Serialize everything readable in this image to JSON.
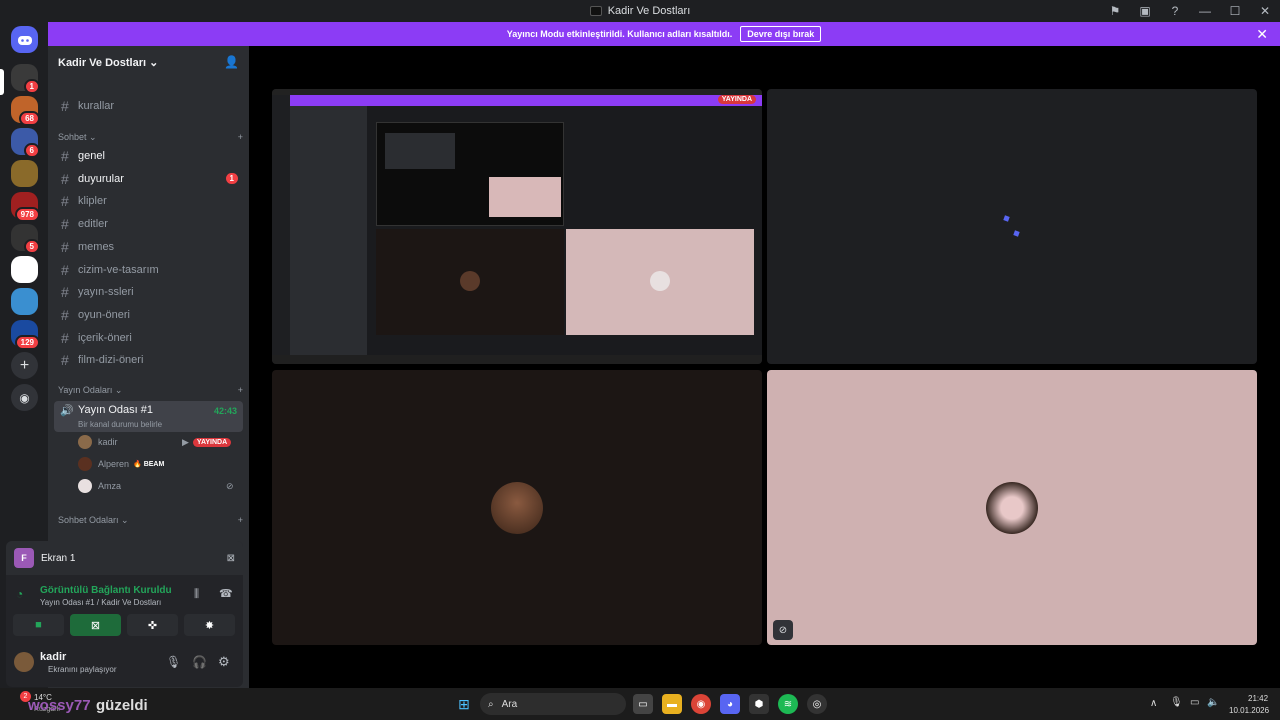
{
  "window": {
    "title": "Kadir Ve Dostları"
  },
  "banner": {
    "text": "Yayıncı Modu etkinleştirildi. Kullanıcı adları kısaltıldı.",
    "button": "Devre dışı bırak"
  },
  "servers": {
    "items": [
      {
        "name": "KADIRCAN",
        "badge": "1",
        "color": "#3a3a3a"
      },
      {
        "name": "server-2",
        "badge": "68",
        "color": "#c0642a"
      },
      {
        "name": "server-3",
        "badge": "6",
        "color": "#3c5aa8"
      },
      {
        "name": "server-4",
        "badge": "",
        "color": "#8a6a2a"
      },
      {
        "name": "server-5",
        "badge": "978",
        "color": "#a02020"
      },
      {
        "name": "server-6",
        "badge": "5",
        "color": "#333333"
      },
      {
        "name": "server-7",
        "badge": "",
        "color": "#ffffff"
      },
      {
        "name": "server-8",
        "badge": "",
        "color": "#3a8fd0"
      },
      {
        "name": "server-9",
        "badge": "129",
        "color": "#1a4aa0"
      }
    ]
  },
  "guild": {
    "name": "Kadir Ve Dostları"
  },
  "channels": {
    "top": "kurallar",
    "cat_chat": "Sohbet",
    "text": [
      {
        "name": "genel",
        "badge": ""
      },
      {
        "name": "duyurular",
        "badge": "1"
      },
      {
        "name": "klipler",
        "badge": ""
      },
      {
        "name": "editler",
        "badge": ""
      },
      {
        "name": "memes",
        "badge": ""
      },
      {
        "name": "cizim-ve-tasarım",
        "badge": ""
      },
      {
        "name": "yayın-ssleri",
        "badge": ""
      },
      {
        "name": "oyun-öneri",
        "badge": ""
      },
      {
        "name": "içerik-öneri",
        "badge": ""
      },
      {
        "name": "film-dizi-öneri",
        "badge": ""
      }
    ],
    "cat_stream": "Yayın Odaları",
    "voice": {
      "name": "Yayın Odası #1",
      "timer": "42:43",
      "status": "Bir kanal durumu belirle"
    },
    "voice_users": [
      {
        "name": "kadir",
        "tag": "YAYINDA"
      },
      {
        "name": "Alperen",
        "tag": "BEAM"
      },
      {
        "name": "Amza",
        "tag": ""
      }
    ],
    "cat_voice": "Sohbet Odaları"
  },
  "panel": {
    "stream": {
      "initial": "F",
      "name": "Ekran 1"
    },
    "connection": {
      "status": "Görüntülü Bağlantı Kuruldu",
      "channel": "Yayın Odası #1 / Kadir Ve Dostları"
    },
    "user": {
      "name": "kadir",
      "status": "Ekranını paylaşıyor"
    }
  },
  "stage": {
    "live_label": "YAYINDA"
  },
  "taskbar": {
    "weather": "14°C",
    "weather_sub": "Rüzgarlı",
    "overlay_name": "wossy77",
    "overlay_text": "güzeldi",
    "search": "Ara",
    "time": "21:42",
    "date": "10.01.2026",
    "notif_badge": "2"
  }
}
